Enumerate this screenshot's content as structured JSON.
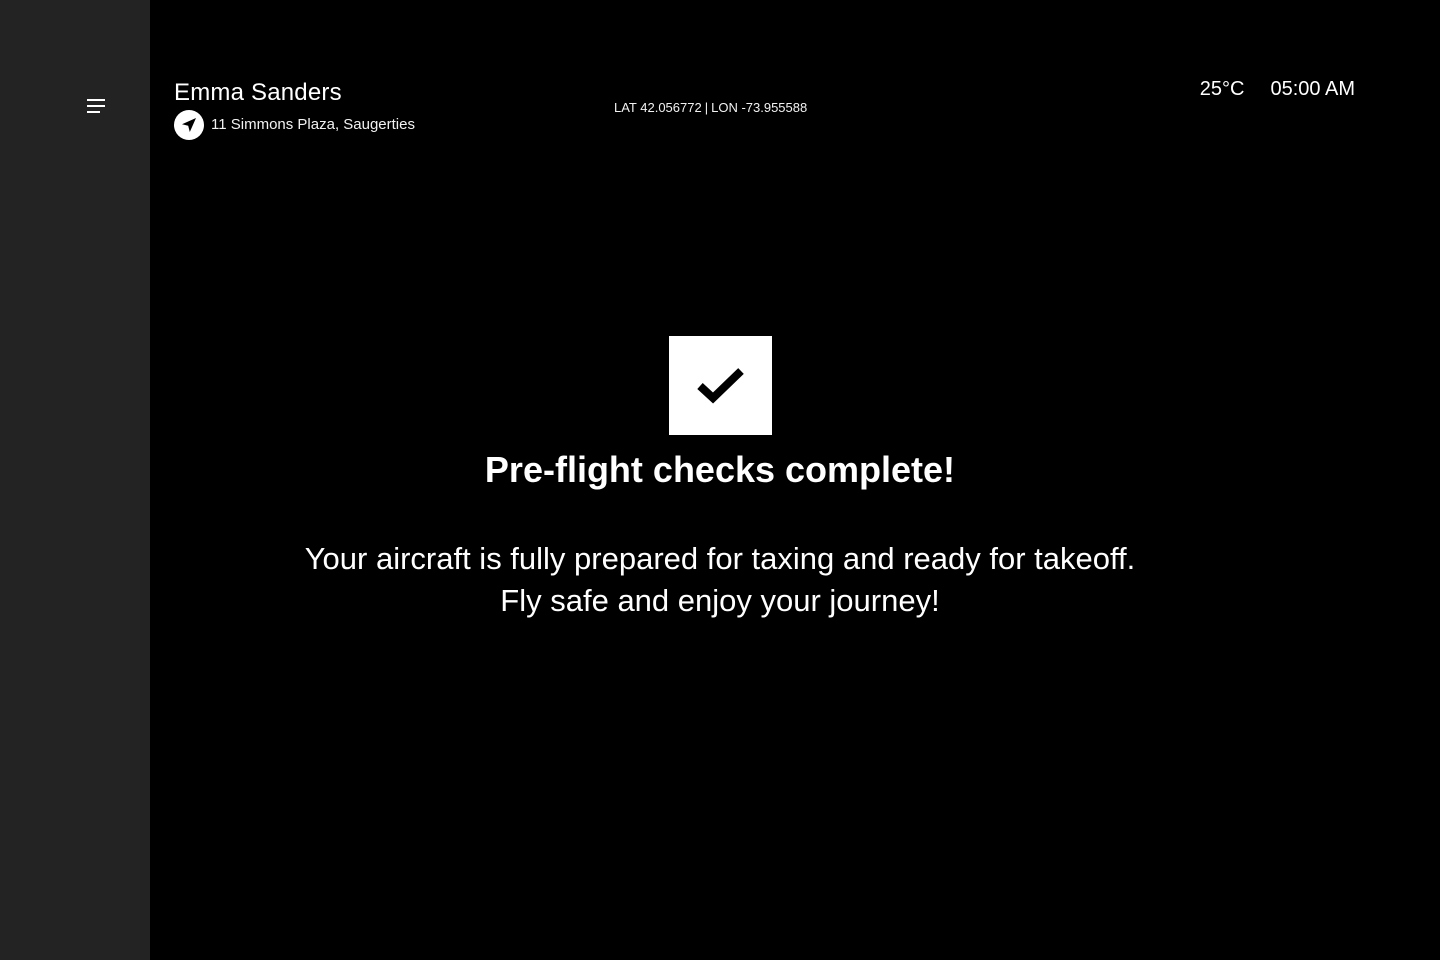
{
  "header": {
    "user_name": "Emma Sanders",
    "address": "11 Simmons Plaza, Saugerties",
    "coords": {
      "lat": "LAT 42.056772",
      "separator": "|",
      "lon": "LON -73.955588"
    },
    "temperature": "25°C",
    "time": "05:00 AM"
  },
  "main": {
    "headline": "Pre-flight checks complete!",
    "message_line1": "Your aircraft is fully prepared for taxing and ready for takeoff.",
    "message_line2": "Fly safe and enjoy your journey!"
  },
  "icons": {
    "menu": "menu-icon",
    "navigation": "navigation-arrow-icon",
    "success": "checkmark-icon"
  },
  "colors": {
    "background": "#000000",
    "sidebar": "#232323",
    "text": "#ffffff",
    "accent": "#ffffff"
  }
}
